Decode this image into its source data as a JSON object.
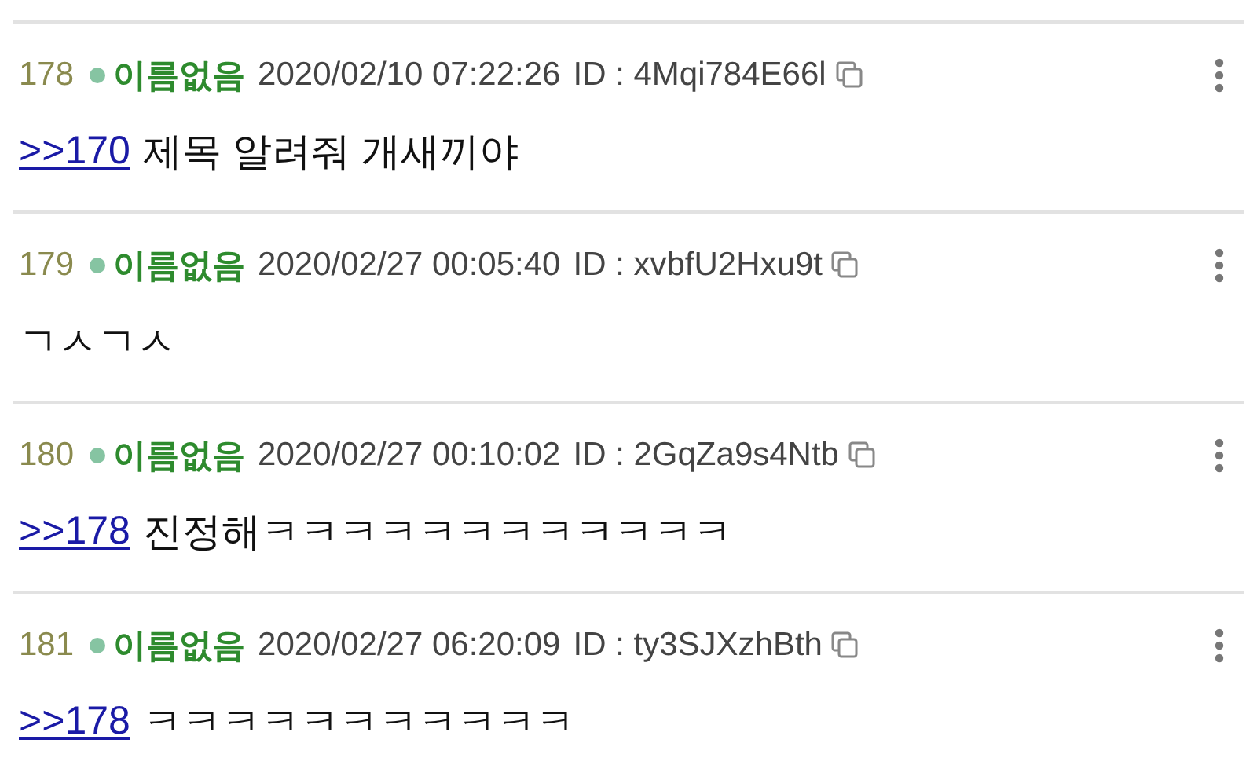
{
  "posts": [
    {
      "number": "178",
      "name": "이름없음",
      "date": "2020/02/10 07:22:26",
      "id": "ID : 4Mqi784E66l",
      "reply": ">>170",
      "text": "제목 알려줘 개새끼야"
    },
    {
      "number": "179",
      "name": "이름없음",
      "date": "2020/02/27 00:05:40",
      "id": "ID : xvbfU2Hxu9t",
      "text": "ㄱㅅㄱㅅ"
    },
    {
      "number": "180",
      "name": "이름없음",
      "date": "2020/02/27 00:10:02",
      "id": "ID : 2GqZa9s4Ntb",
      "reply": ">>178",
      "text": "진정해ㅋㅋㅋㅋㅋㅋㅋㅋㅋㅋㅋㅋ"
    },
    {
      "number": "181",
      "name": "이름없음",
      "date": "2020/02/27 06:20:09",
      "id": "ID : ty3SJXzhBth",
      "reply": ">>178",
      "text": "ㅋㅋㅋㅋㅋㅋㅋㅋㅋㅋㅋ"
    }
  ]
}
